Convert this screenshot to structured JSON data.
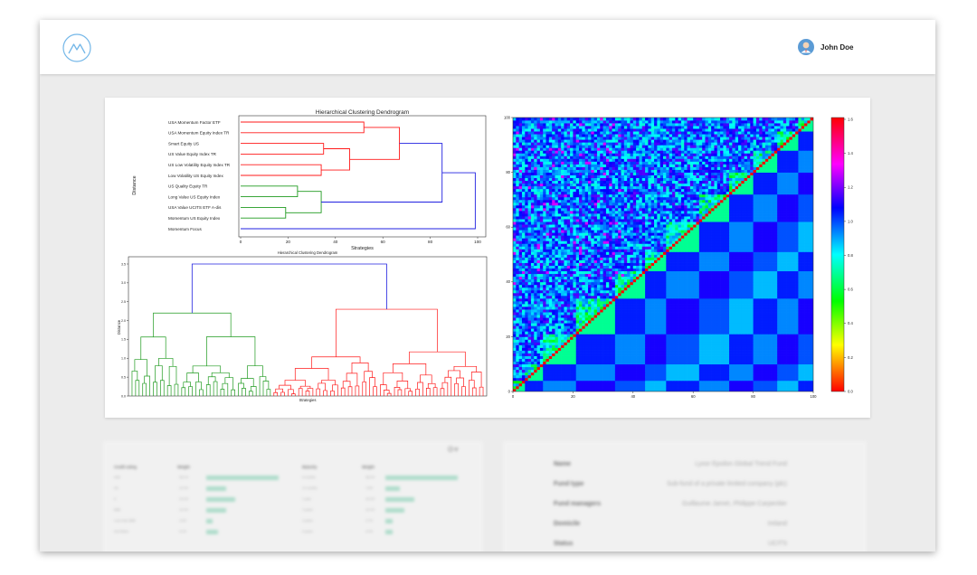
{
  "app": {
    "user_name": "John Doe",
    "colors": {
      "accent": "#74b7e8",
      "bar": "#9fd9c3"
    }
  },
  "icons": {
    "logo": "mountain-logo-icon",
    "avatar": "user-avatar-icon",
    "settings": "gear-icon"
  },
  "chart_data": [
    {
      "type": "dendrogram",
      "title": "Hierarchical Clustering Dendrogram",
      "ylabel": "Distance",
      "xlabel": "Strategies",
      "orientation": "horizontal",
      "labels": [
        "USA Momentum Factor ETF",
        "USA Momentum Equity Index TR",
        "Smart Equity US",
        "US Value Equity Index TR",
        "US Low Volatility Equity Index TR",
        "Low Volatility US Equity Index",
        "US Quality Equity TR",
        "Long Value US Equity Index",
        "USA Value UCITS ETF A-dis",
        "Momentum US Equity Index",
        "Momentum Focus"
      ],
      "x_ticks": [
        "0",
        "20",
        "40",
        "60",
        "80",
        "100"
      ],
      "xlim": [
        0,
        100
      ],
      "merges": [
        {
          "leaves": [
            0,
            1
          ],
          "distance": 52,
          "color": "red"
        },
        {
          "leaves": [
            2,
            3
          ],
          "distance": 35,
          "color": "red"
        },
        {
          "leaves": [
            4,
            5
          ],
          "distance": 34,
          "color": "red"
        },
        {
          "leaves": [
            "2-3",
            "4-5"
          ],
          "distance": 46,
          "color": "red"
        },
        {
          "leaves": [
            "0-1",
            "2-5"
          ],
          "distance": 67,
          "color": "red"
        },
        {
          "leaves": [
            6,
            7
          ],
          "distance": 24,
          "color": "green"
        },
        {
          "leaves": [
            8,
            9
          ],
          "distance": 19,
          "color": "green"
        },
        {
          "leaves": [
            "6-7",
            "8-9"
          ],
          "distance": 34,
          "color": "green"
        },
        {
          "leaves": [
            "0-5",
            "6-9"
          ],
          "distance": 85,
          "color": "blue"
        },
        {
          "leaves": [
            "0-9",
            10
          ],
          "distance": 99,
          "color": "blue"
        }
      ]
    },
    {
      "type": "dendrogram",
      "title": "Hierarchical Clustering Dendrogram",
      "ylabel": "Distance",
      "xlabel": "Strategies",
      "orientation": "vertical",
      "y_ticks": [
        "0.0",
        "0.5",
        "1.0",
        "1.5",
        "2.0",
        "2.5",
        "3.0",
        "3.5"
      ],
      "ylim": [
        0,
        3.5
      ],
      "clusters": [
        {
          "color": "green",
          "leaves": 40,
          "merge_distance": 2.2
        },
        {
          "color": "red",
          "leaves": 60,
          "merge_distance": 2.3
        }
      ],
      "root_distance": 3.5
    },
    {
      "type": "heatmap",
      "x_ticks": [
        "0",
        "20",
        "40",
        "60",
        "80",
        "100"
      ],
      "y_ticks": [
        "0",
        "20",
        "40",
        "60",
        "80",
        "100"
      ],
      "xlim": [
        0,
        100
      ],
      "ylim": [
        0,
        100
      ],
      "colorbar_ticks": [
        "0.0",
        "0.2",
        "0.4",
        "0.6",
        "0.8",
        "1.0",
        "1.2",
        "1.4",
        "1.6"
      ],
      "colorbar_range": [
        0,
        1.6
      ],
      "colormap": "hsv",
      "diagonal_value": 0.0
    }
  ],
  "credit_table": {
    "headers": [
      "Credit rating",
      "Weight"
    ],
    "rows": [
      {
        "label": "AAA",
        "value": "38.1%",
        "fraction": 0.381
      },
      {
        "label": "AA",
        "value": "10.4%",
        "fraction": 0.104
      },
      {
        "label": "A",
        "value": "15.3%",
        "fraction": 0.153
      },
      {
        "label": "BBB",
        "value": "10.4%",
        "fraction": 0.104
      },
      {
        "label": "Less than BBB",
        "value": "3.5%",
        "fraction": 0.035
      },
      {
        "label": "Not Rated",
        "value": "6.2%",
        "fraction": 0.062
      }
    ]
  },
  "maturity_table": {
    "headers": [
      "Maturity",
      "Weight"
    ],
    "rows": [
      {
        "label": "6 months",
        "value": "38.0%",
        "fraction": 0.38
      },
      {
        "label": "12 months",
        "value": "7.8%",
        "fraction": 0.078
      },
      {
        "label": "1 year",
        "value": "15.2%",
        "fraction": 0.152
      },
      {
        "label": "2 years",
        "value": "10.2%",
        "fraction": 0.102
      },
      {
        "label": "3 years",
        "value": "3.7%",
        "fraction": 0.037
      },
      {
        "label": "5 years",
        "value": "4.0%",
        "fraction": 0.04
      }
    ]
  },
  "fund_info": [
    {
      "label": "Name",
      "value": "Lyxor Epsilon Global Trend Fund"
    },
    {
      "label": "Fund type",
      "value": "Sub-fund of a private limited company (plc)"
    },
    {
      "label": "Fund managers",
      "value": "Guillaume Jamet, Philippe Carpentier"
    },
    {
      "label": "Domicile",
      "value": "Ireland"
    },
    {
      "label": "Status",
      "value": "UCITS"
    }
  ]
}
